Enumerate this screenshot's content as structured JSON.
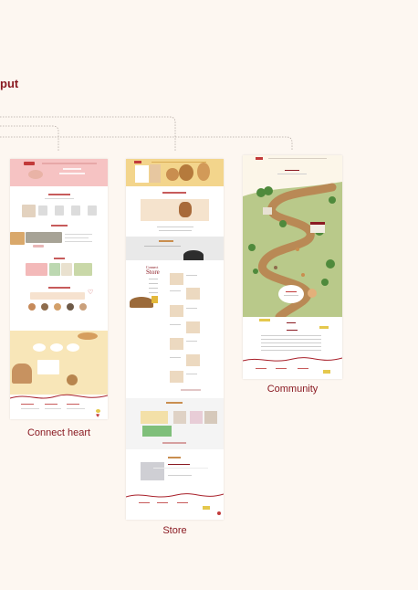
{
  "section": {
    "label": "put"
  },
  "thumbnails": [
    {
      "id": "connect",
      "caption": "Connect heart"
    },
    {
      "id": "store",
      "caption": "Store",
      "heading": "Store"
    },
    {
      "id": "community",
      "caption": "Community"
    }
  ],
  "colors": {
    "background": "#fdf7f1",
    "accent": "#8a1a22",
    "connector": "#b3a9a3",
    "connect_hero": "#f6c3c3",
    "store_hero": "#f3d58c",
    "community_map": "#b9c98a",
    "path": "#b98955"
  }
}
